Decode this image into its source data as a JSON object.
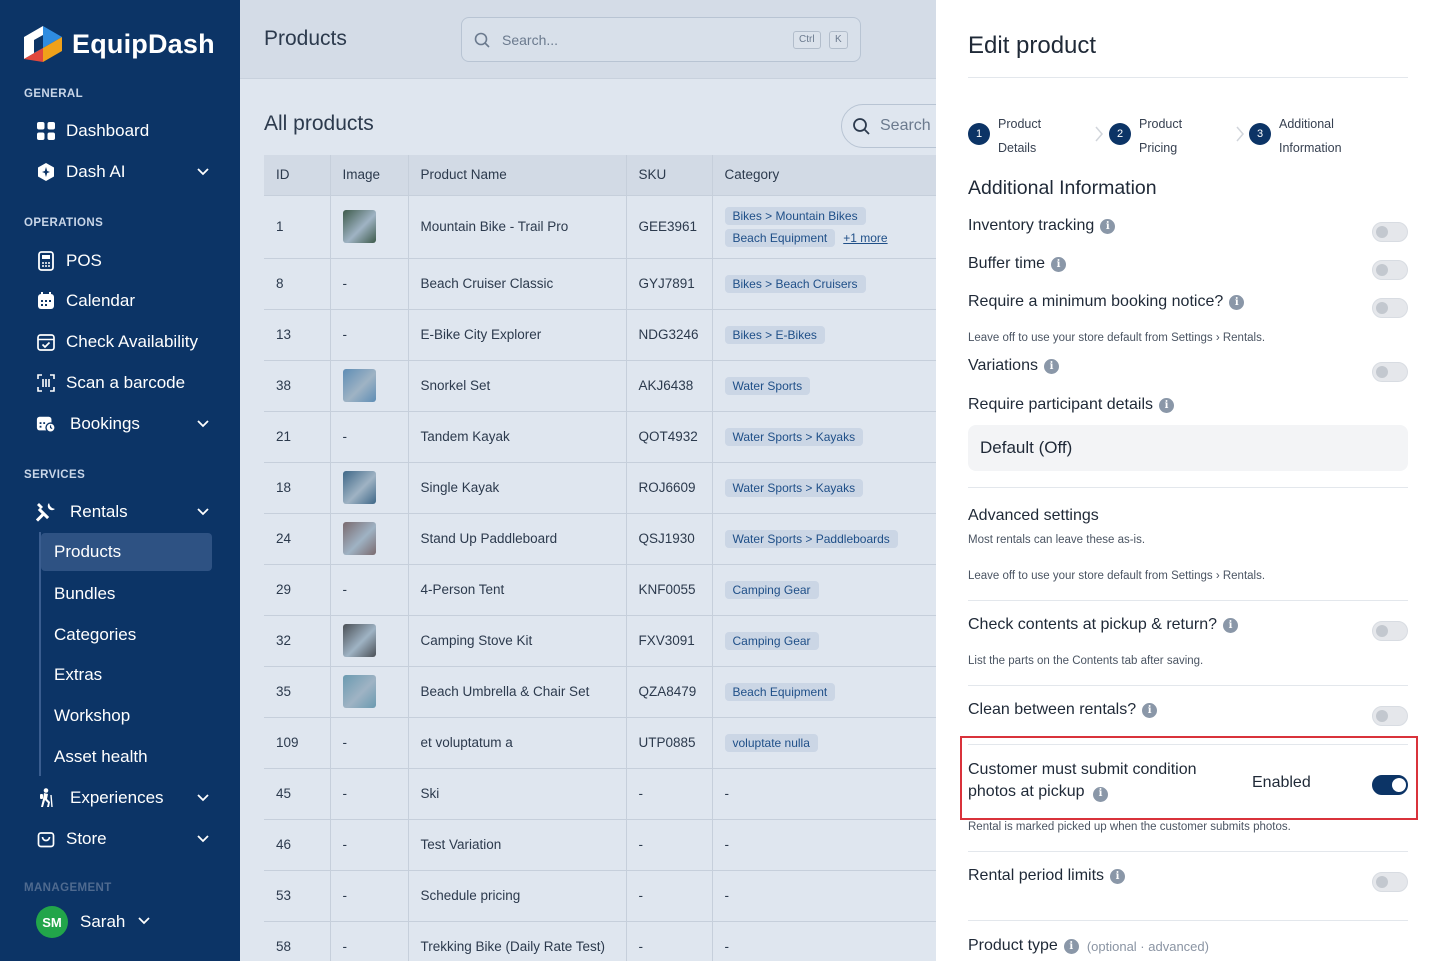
{
  "app": {
    "name": "EquipDash",
    "colors": {
      "sidebar": "#0c3466",
      "accent": "#0c3466",
      "highlight_border": "#d9323b",
      "tag_text": "#1f4f88"
    }
  },
  "sidebar": {
    "sections": {
      "general": "GENERAL",
      "operations": "OPERATIONS",
      "services": "SERVICES",
      "management": "MANAGEMENT"
    },
    "items": {
      "dashboard": "Dashboard",
      "dash_ai": "Dash AI",
      "pos": "POS",
      "calendar": "Calendar",
      "check_availability": "Check Availability",
      "scan_barcode": "Scan a barcode",
      "bookings": "Bookings",
      "rentals": "Rentals",
      "experiences": "Experiences",
      "store": "Store"
    },
    "rentals_sub": {
      "products": "Products",
      "bundles": "Bundles",
      "categories": "Categories",
      "extras": "Extras",
      "workshop": "Workshop",
      "asset_health": "Asset health"
    },
    "user": {
      "initials": "SM",
      "name": "Sarah"
    }
  },
  "header": {
    "title": "Products",
    "search_placeholder": "Search...",
    "kbd_ctrl": "Ctrl",
    "kbd_k": "K"
  },
  "content": {
    "title": "All products",
    "search_placeholder": "Search",
    "columns": [
      "ID",
      "Image",
      "Product Name",
      "SKU",
      "Category"
    ],
    "rows": [
      {
        "id": "1",
        "image": "photo",
        "name": "Mountain Bike - Trail Pro",
        "sku": "GEE3961",
        "tags": [
          "Bikes > Mountain Bikes",
          "Beach Equipment"
        ],
        "more": "+1 more",
        "thumb_color": "#3d5a4a"
      },
      {
        "id": "8",
        "image": "-",
        "name": "Beach Cruiser Classic",
        "sku": "GYJ7891",
        "tags": [
          "Bikes > Beach Cruisers"
        ]
      },
      {
        "id": "13",
        "image": "-",
        "name": "E-Bike City Explorer",
        "sku": "NDG3246",
        "tags": [
          "Bikes > E-Bikes"
        ]
      },
      {
        "id": "38",
        "image": "photo",
        "name": "Snorkel Set",
        "sku": "AKJ6438",
        "tags": [
          "Water Sports"
        ],
        "thumb_color": "#5e8db5"
      },
      {
        "id": "21",
        "image": "-",
        "name": "Tandem Kayak",
        "sku": "QOT4932",
        "tags": [
          "Water Sports > Kayaks"
        ]
      },
      {
        "id": "18",
        "image": "photo",
        "name": "Single Kayak",
        "sku": "ROJ6609",
        "tags": [
          "Water Sports > Kayaks"
        ],
        "thumb_color": "#3e6787"
      },
      {
        "id": "24",
        "image": "photo",
        "name": "Stand Up Paddleboard",
        "sku": "QSJ1930",
        "tags": [
          "Water Sports > Paddleboards"
        ],
        "thumb_color": "#7a6a6e"
      },
      {
        "id": "29",
        "image": "-",
        "name": "4-Person Tent",
        "sku": "KNF0055",
        "tags": [
          "Camping Gear"
        ]
      },
      {
        "id": "32",
        "image": "photo",
        "name": "Camping Stove Kit",
        "sku": "FXV3091",
        "tags": [
          "Camping Gear"
        ],
        "thumb_color": "#4a4f55"
      },
      {
        "id": "35",
        "image": "photo",
        "name": "Beach Umbrella & Chair Set",
        "sku": "QZA8479",
        "tags": [
          "Beach Equipment"
        ],
        "thumb_color": "#6a9ab0"
      },
      {
        "id": "109",
        "image": "-",
        "name": "et voluptatum a",
        "sku": "UTP0885",
        "tags": [
          "voluptate nulla"
        ]
      },
      {
        "id": "45",
        "image": "-",
        "name": "Ski",
        "sku": "-",
        "category": "-"
      },
      {
        "id": "46",
        "image": "-",
        "name": "Test Variation",
        "sku": "-",
        "category": "-"
      },
      {
        "id": "53",
        "image": "-",
        "name": "Schedule pricing",
        "sku": "-",
        "category": "-"
      },
      {
        "id": "58",
        "image": "-",
        "name": "Trekking Bike (Daily Rate Test)",
        "sku": "-",
        "category": "-"
      }
    ]
  },
  "drawer": {
    "title": "Edit product",
    "steps": [
      {
        "num": "1",
        "line1": "Product",
        "line2": "Details"
      },
      {
        "num": "2",
        "line1": "Product",
        "line2": "Pricing"
      },
      {
        "num": "3",
        "line1": "Additional",
        "line2": "Information"
      }
    ],
    "section_title": "Additional Information",
    "inventory_tracking": "Inventory tracking",
    "buffer_time": "Buffer time",
    "min_notice": "Require a minimum booking notice?",
    "store_default_hint": "Leave off to use your store default from Settings › Rentals.",
    "variations": "Variations",
    "participant_details": "Require participant details",
    "participant_value": "Default (Off)",
    "advanced_title": "Advanced settings",
    "advanced_sub": "Most rentals can leave these as-is.",
    "check_contents": "Check contents at pickup & return?",
    "check_contents_hint": "List the parts on the Contents tab after saving.",
    "clean_between": "Clean between rentals?",
    "condition_photos_line1": "Customer must submit condition",
    "condition_photos_line2": "photos at pickup",
    "condition_status": "Enabled",
    "condition_hint": "Rental is marked picked up when the customer submits photos.",
    "period_limits": "Rental period limits",
    "product_type": "Product type",
    "product_type_note": "(optional · advanced)"
  }
}
